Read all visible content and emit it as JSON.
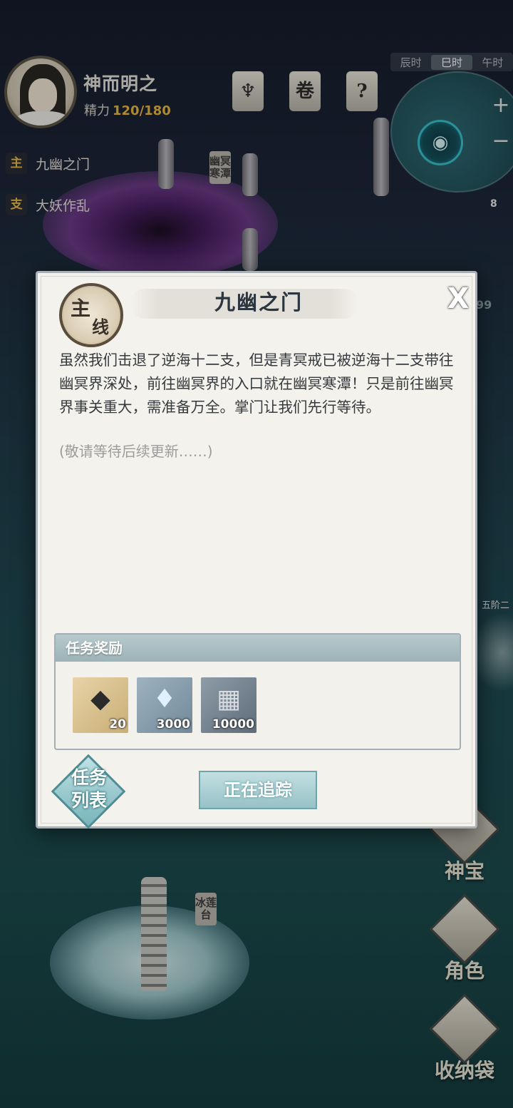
{
  "player": {
    "name": "神而明之",
    "stamina_label": "精力",
    "stamina_value": "120/180"
  },
  "hud_icons": [
    "lotus-icon",
    "scroll-icon",
    "quest-scroll-icon"
  ],
  "time_bar": {
    "slots": [
      "辰时",
      "巳时",
      "午时"
    ],
    "active_index": 1
  },
  "minimap": {
    "zoom_in": "+",
    "zoom_out": "−"
  },
  "quest_tracker": [
    {
      "tag": "主",
      "label": "九幽之门"
    },
    {
      "tag": "支",
      "label": "大妖作乱"
    }
  ],
  "map_signs": {
    "pool": "幽冥寒潭",
    "lotus": "冰莲台"
  },
  "side_panel": {
    "badge_count": "8",
    "peek_number": "99",
    "peek_text": "五阶二",
    "buttons": [
      {
        "label": "神宝",
        "icon": "treasure-icon"
      },
      {
        "label": "角色",
        "icon": "character-icon"
      },
      {
        "label": "收纳袋",
        "icon": "bag-icon"
      }
    ]
  },
  "modal": {
    "seal_chars": [
      "主",
      "线"
    ],
    "title": "九幽之门",
    "close_label": "X",
    "description": "虽然我们击退了逆海十二支，但是青冥戒已被逆海十二支带往幽冥界深处，前往幽冥界的入口就在幽冥寒潭！只是前往幽冥界事关重大，需准备万全。掌门让我们先行等待。",
    "description_sub": "(敬请等待后续更新……)",
    "reward_header": "任务奖励",
    "rewards": [
      {
        "icon": "gold-crystal-icon",
        "count": "20"
      },
      {
        "icon": "spirit-stone-icon",
        "count": "3000"
      },
      {
        "icon": "scroll-bundle-icon",
        "count": "10000"
      }
    ],
    "list_button": "任务列表",
    "list_button_lines": [
      "任务",
      "列表"
    ],
    "track_button": "正在追踪"
  },
  "colors": {
    "accent": "#e8b740",
    "panel_bg": "#f4f2ec",
    "button_teal": "#96c2c7"
  }
}
